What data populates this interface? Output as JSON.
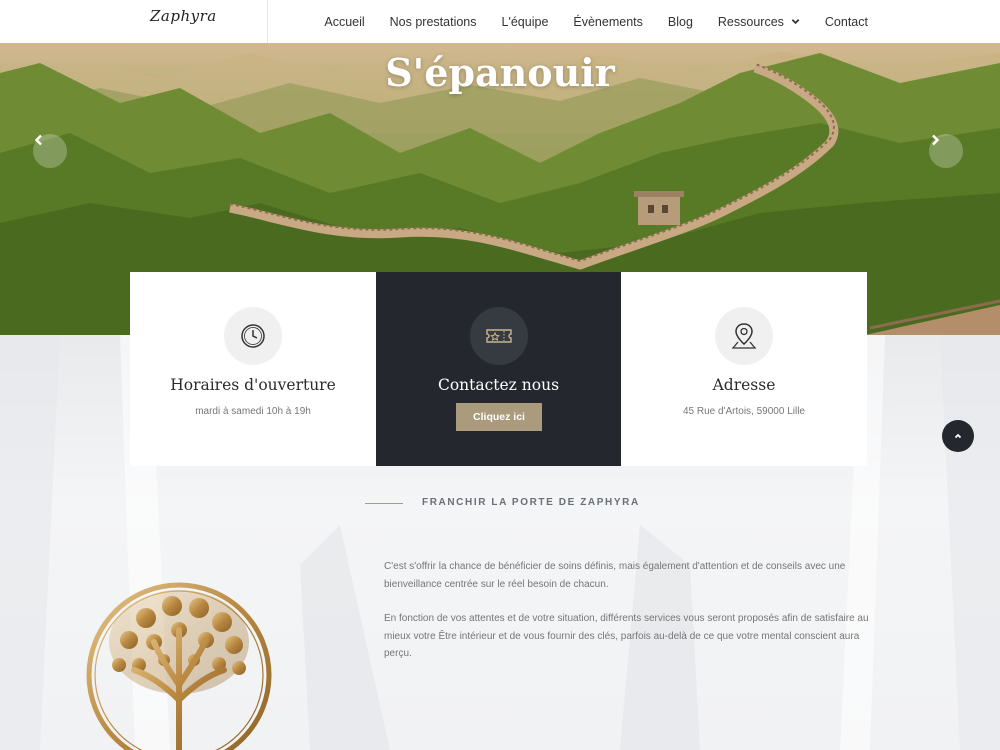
{
  "header": {
    "logo_text": "Zaphyra",
    "nav": [
      {
        "label": "Accueil"
      },
      {
        "label": "Nos prestations"
      },
      {
        "label": "L'équipe"
      },
      {
        "label": "Évènements"
      },
      {
        "label": "Blog"
      },
      {
        "label": "Ressources",
        "has_dropdown": true
      },
      {
        "label": "Contact"
      }
    ]
  },
  "hero": {
    "title": "S'épanouir",
    "prev_icon": "chevron-left-icon",
    "next_icon": "chevron-right-icon"
  },
  "cards": [
    {
      "icon": "clock-icon",
      "title": "Horaires d'ouverture",
      "text": "mardi à samedi 10h à 19h"
    },
    {
      "icon": "ticket-icon",
      "title": "Contactez nous",
      "button": "Cliquez ici"
    },
    {
      "icon": "map-pin-icon",
      "title": "Adresse",
      "text": "45 Rue d'Artois, 59000 Lille"
    }
  ],
  "section": {
    "title": "FRANCHIR LA PORTE DE ZAPHYRA",
    "paragraphs": [
      "C'est s'offrir la chance de bénéficier de soins définis, mais également d'attention et de conseils avec une bienveillance centrée sur le réel besoin de chacun.",
      "En fonction de vos attentes et de votre situation, différents services vous seront proposés afin de satisfaire au mieux votre Être intérieur et de vous fournir des clés, parfois au-delà de ce que votre mental conscient aura perçu."
    ]
  },
  "colors": {
    "accent": "#a99b7c",
    "dark": "#24272d",
    "line_gold": "#b29c74"
  }
}
